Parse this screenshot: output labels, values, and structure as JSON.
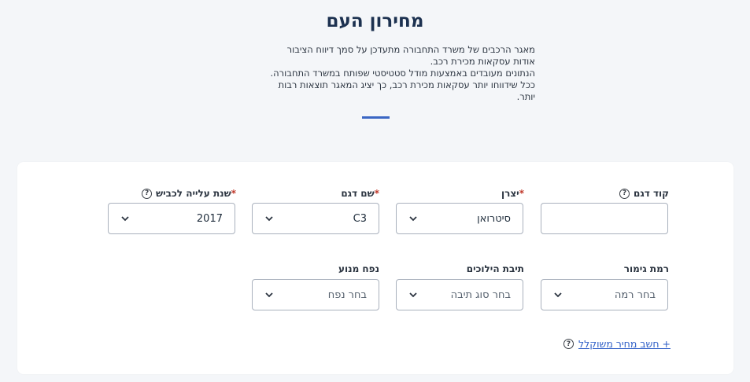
{
  "header": {
    "title": "מחירון העם",
    "description_lines": [
      "מאגר הרכבים של משרד התחבורה מתעדכן על סמך דיווח הציבור",
      "אודות עסקאות מכירת רכב.",
      "הנתונים מעובדים באמצעות מודל סטטיסטי שפותח במשרד התחבורה.",
      "ככל שידווחו יותר עסקאות מכירת רכב, כך יציג המאגר תוצאות רבות",
      "יותר."
    ]
  },
  "form": {
    "model_code": {
      "label": "קוד דגם",
      "value": ""
    },
    "manufacturer": {
      "label": "יצרן",
      "required_mark": "*",
      "value": "סיטרואן"
    },
    "model_name": {
      "label": "שם דגם",
      "required_mark": "*",
      "value": "C3"
    },
    "year": {
      "label": "שנת עלייה לכביש",
      "required_mark": "*",
      "value": "2017"
    },
    "trim_level": {
      "label": "רמת גימור",
      "placeholder": "בחר רמה"
    },
    "gearbox": {
      "label": "תיבת הילוכים",
      "placeholder": "בחר סוג תיבה"
    },
    "engine_volume": {
      "label": "נפח מנוע",
      "placeholder": "בחר נפח"
    },
    "help_glyph": "?"
  },
  "weighted_price_link": {
    "label": "+ חשב מחיר משוקלל"
  },
  "colors": {
    "accent": "#3a66c4",
    "required": "#c0392b",
    "link": "#2f5fc7"
  }
}
